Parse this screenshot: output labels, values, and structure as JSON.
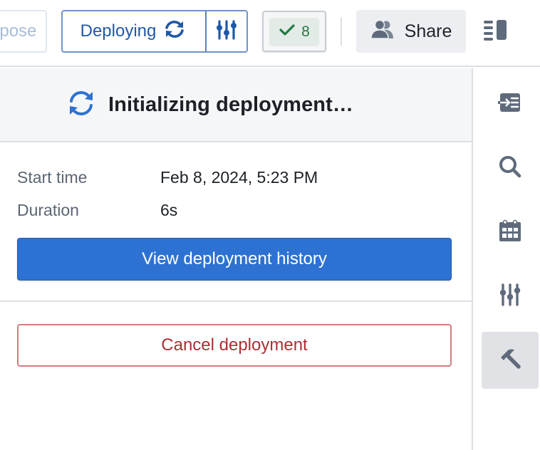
{
  "toolbar": {
    "propose_label": "Propose",
    "deploy_label": "Deploying",
    "deploy_status_icon": "sync-icon",
    "deploy_settings_icon": "sliders-icon",
    "checks_icon": "check-icon",
    "checks_count": "8",
    "share_label": "Share",
    "share_icon": "people-icon",
    "panel_toggle_icon": "panel-layout-icon"
  },
  "status": {
    "icon": "sync-icon",
    "title": "Initializing deployment…"
  },
  "details": {
    "start_time_label": "Start time",
    "start_time_value": "Feb 8, 2024, 5:23 PM",
    "duration_label": "Duration",
    "duration_value": "6s",
    "history_button": "View deployment history"
  },
  "actions": {
    "cancel_button": "Cancel deployment"
  },
  "rail": {
    "items": [
      {
        "icon": "import-icon",
        "active": false
      },
      {
        "icon": "search-icon",
        "active": false
      },
      {
        "icon": "calendar-icon",
        "active": false
      },
      {
        "icon": "sliders-icon",
        "active": false
      },
      {
        "icon": "hammer-icon",
        "active": true
      }
    ]
  },
  "colors": {
    "primary": "#2d72d2",
    "deploy_text": "#2059a8",
    "success": "#217a45",
    "danger": "#ac2f33",
    "icon_gray": "#5f6b7c"
  }
}
